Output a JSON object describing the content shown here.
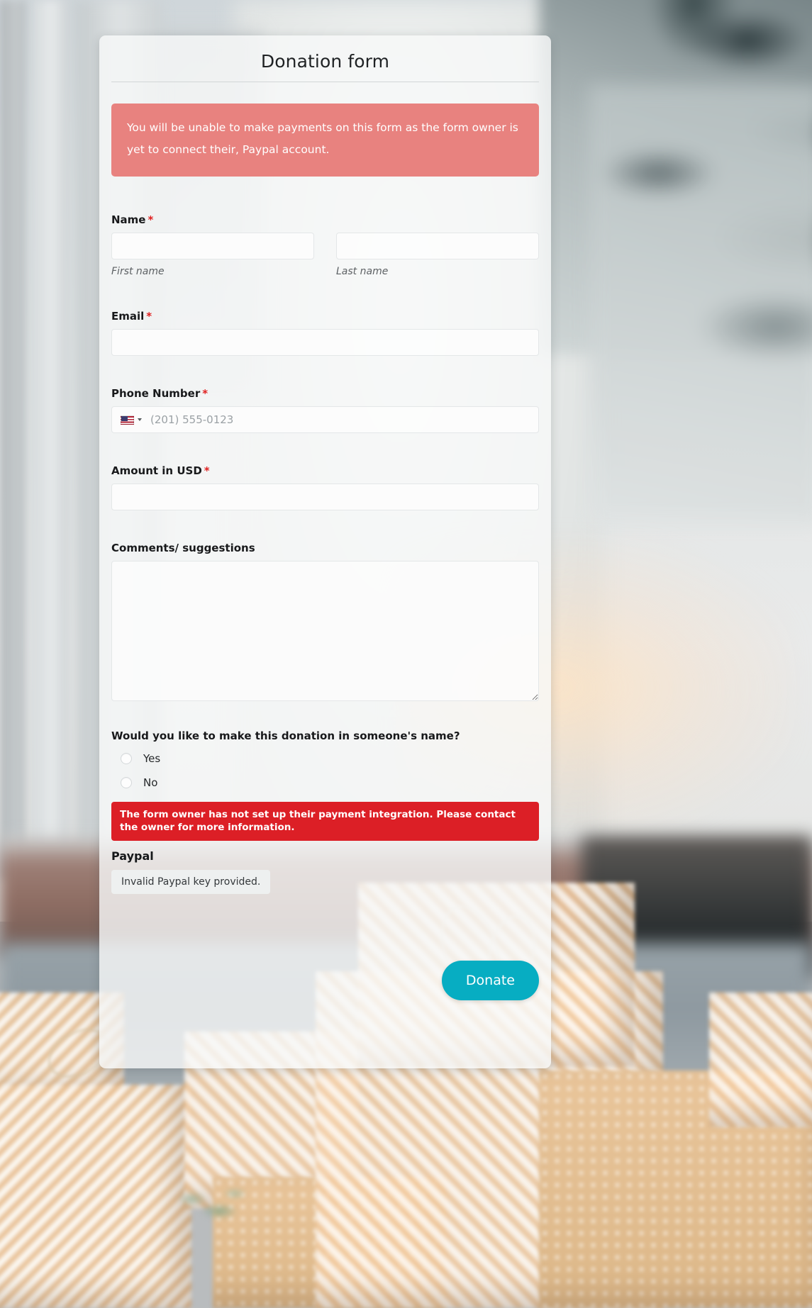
{
  "form": {
    "title": "Donation form",
    "paypal_notice": "You will be unable to make payments on this form as the form owner is yet to connect their, Paypal account.",
    "fields": {
      "name": {
        "label": "Name",
        "required_mark": "*",
        "first": {
          "value": "",
          "placeholder": "",
          "sub_label": "First name"
        },
        "last": {
          "value": "",
          "placeholder": "",
          "sub_label": "Last name"
        }
      },
      "email": {
        "label": "Email",
        "required_mark": "*",
        "value": "",
        "placeholder": ""
      },
      "phone": {
        "label": "Phone Number",
        "required_mark": "*",
        "country_flag": "us-flag-icon",
        "value": "",
        "placeholder": "(201) 555-0123"
      },
      "amount": {
        "label": "Amount in USD",
        "required_mark": "*",
        "value": "",
        "placeholder": ""
      },
      "comments": {
        "label": "Comments/ suggestions",
        "value": "",
        "placeholder": ""
      }
    },
    "radio_group": {
      "question": "Would you like to make this donation in someone's name?",
      "options": [
        {
          "label": "Yes",
          "selected": false
        },
        {
          "label": "No",
          "selected": false
        }
      ]
    },
    "payment_error": "The form owner has not set up their payment integration. Please contact the owner for more information.",
    "payment": {
      "method_title": "Paypal",
      "key_message": "Invalid Paypal key provided."
    },
    "submit_label": "Donate"
  },
  "colors": {
    "notice_bg": "#e8827f",
    "error_bg": "#dc1f26",
    "required_star": "#e02020",
    "donate_button": "#07adc2",
    "card_bg": "#f7f9f9"
  }
}
